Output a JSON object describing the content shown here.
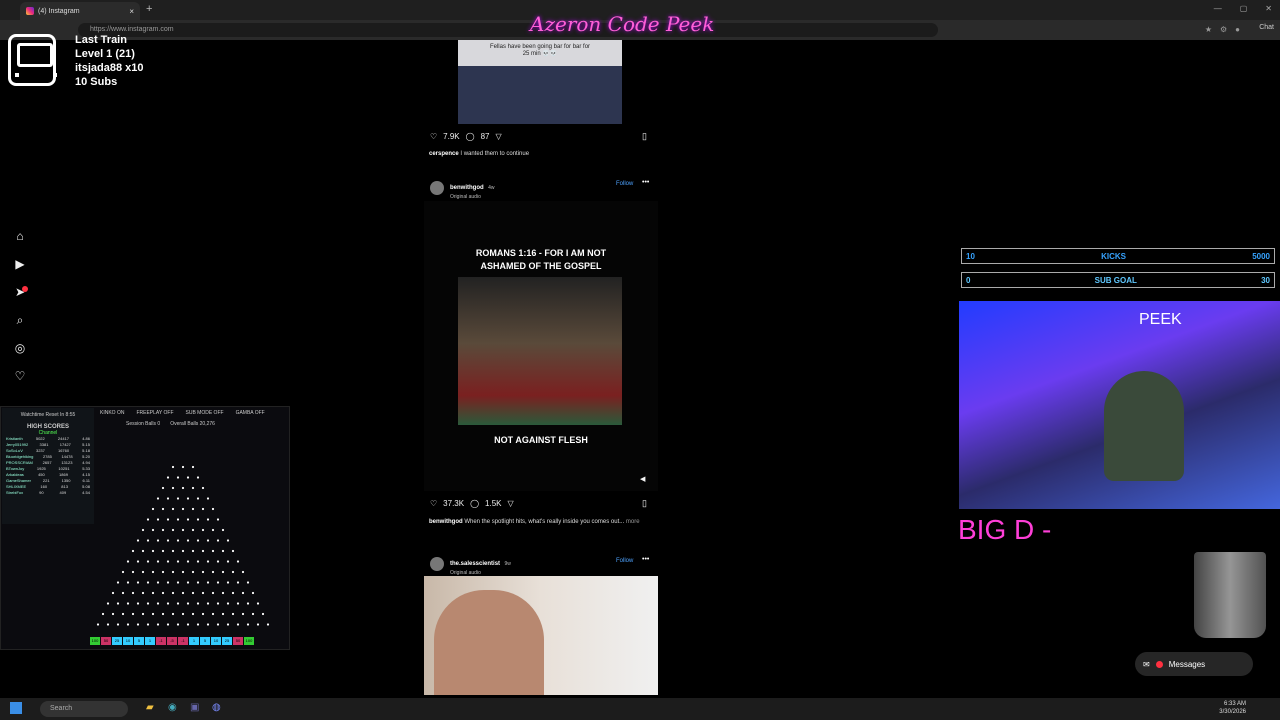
{
  "browser": {
    "tab_title": "(4) Instagram",
    "url": "https://www.instagram.com",
    "chat_label": "Chat"
  },
  "overlay": {
    "title": "Azeron Code Peek",
    "train_name": "Last Train",
    "train_level": "Level 1  (21)",
    "train_user": "itsjada88 x10",
    "train_subs": "10 Subs"
  },
  "plinko": {
    "reset_label": "Watchtime Reset In 8:55",
    "modes": [
      "KINKO ON",
      "FREEPLAY OFF",
      "SUB MODE OFF",
      "GAMBA OFF"
    ],
    "session_label": "Session Balls  0",
    "overall_label": "Overall Balls  20,276",
    "hs_title": "HIGH SCORES",
    "hs_sub": "Channel",
    "scores": [
      [
        "Kristianth",
        "5022",
        "24417",
        "4.86"
      ],
      [
        "Jerry051992",
        "3381",
        "17427",
        "5.15"
      ],
      [
        "SoSoLuV",
        "3237",
        "16760",
        "5.18"
      ],
      [
        "Bluoridgehiking",
        "2785",
        "14478",
        "5.20"
      ],
      [
        "PROSSCRIAM",
        "2657",
        "13123",
        "4.94"
      ],
      [
        "BTownJoy",
        "1925",
        "10251",
        "5.33"
      ],
      [
        "Arkaldeas",
        "450",
        "1869",
        "4.15"
      ],
      [
        "GameShamer",
        "221",
        "1350",
        "6.11"
      ],
      [
        "SHLIXMEE",
        "160",
        "813",
        "5.08"
      ],
      [
        "StrebiFox",
        "90",
        "409",
        "4.54"
      ]
    ],
    "bins": [
      "100",
      "50",
      "25",
      "10",
      "5",
      "1",
      "-1",
      "-5",
      "-1",
      "1",
      "5",
      "10",
      "25",
      "50",
      "100"
    ]
  },
  "feed": {
    "post1": {
      "media_text": "Fellas have been going bar for bar for 25 min 💀💀",
      "likes": "7.9K",
      "comments": "87",
      "caption_user": "cerspence",
      "caption_text": "I wanted them to continue"
    },
    "post2": {
      "user": "benwithgod",
      "time": "4w",
      "audio": "Original audio",
      "follow": "Follow",
      "headline": "ROMANS 1:16 - FOR I AM NOT ASHAMED OF THE GOSPEL",
      "bottom_text": "NOT AGAINST FLESH",
      "likes": "37.3K",
      "comments": "1.5K",
      "caption_user": "benwithgod",
      "caption_text": "When the spotlight hits, what's really inside you comes out...",
      "more": "more"
    },
    "post3": {
      "user": "the.salesscientist",
      "time": "9w",
      "audio": "Original audio",
      "follow": "Follow"
    }
  },
  "goals": {
    "kicks_current": "10",
    "kicks_label": "KICKS",
    "kicks_target": "5000",
    "sub_current": "0",
    "sub_label": "SUB GOAL",
    "sub_target": "30"
  },
  "cam": {
    "label": "PEEK"
  },
  "bigd": "BIG D -",
  "messages": {
    "label": "Messages",
    "badge": "4"
  },
  "taskbar": {
    "search": "Search",
    "time": "6:33 AM",
    "date": "3/30/2026"
  },
  "colors": {
    "accent_pink": "#ff3fd8",
    "accent_blue": "#36a3ff",
    "ig_blue": "#4ea3ff"
  }
}
